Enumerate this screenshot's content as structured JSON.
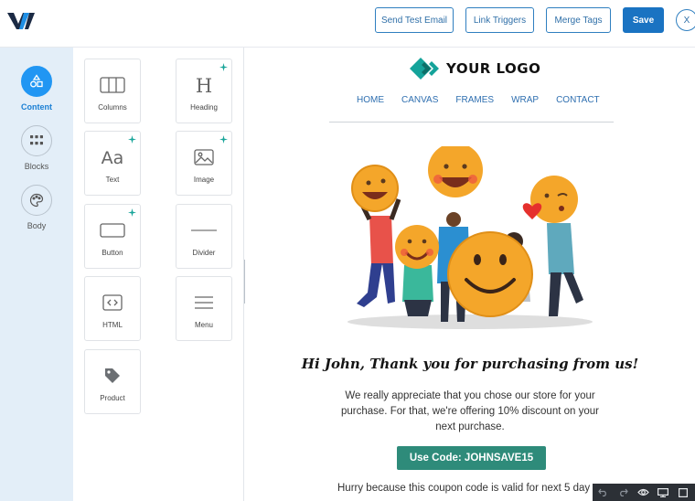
{
  "toolbar": {
    "send_test": "Send Test Email",
    "link_triggers": "Link Triggers",
    "merge_tags": "Merge Tags",
    "save": "Save",
    "close": "X"
  },
  "rail": [
    {
      "label": "Content",
      "icon": "shapes-icon",
      "active": true
    },
    {
      "label": "Blocks",
      "icon": "grid-icon",
      "active": false
    },
    {
      "label": "Body",
      "icon": "palette-icon",
      "active": false
    }
  ],
  "tools": [
    {
      "label": "Columns",
      "icon": "columns-icon",
      "ai": false
    },
    {
      "label": "Heading",
      "icon": "heading-icon",
      "ai": true
    },
    {
      "label": "Text",
      "icon": "text-icon",
      "ai": true
    },
    {
      "label": "Image",
      "icon": "image-icon",
      "ai": true
    },
    {
      "label": "Button",
      "icon": "button-icon",
      "ai": true
    },
    {
      "label": "Divider",
      "icon": "divider-icon",
      "ai": false
    },
    {
      "label": "HTML",
      "icon": "code-icon",
      "ai": false
    },
    {
      "label": "Menu",
      "icon": "menu-icon",
      "ai": false
    },
    {
      "label": "Product",
      "icon": "tag-icon",
      "ai": false
    }
  ],
  "email": {
    "logo_text": "YOUR LOGO",
    "nav": [
      "HOME",
      "CANVAS",
      "FRAMES",
      "WRAP",
      "CONTACT"
    ],
    "headline": "Hi John, Thank you for purchasing from us!",
    "body": "We really appreciate that you chose our store for your purchase. For that, we're offering 10% discount on your next purchase.",
    "coupon": "Use Code: JOHNSAVE15",
    "hurry": "Hurry because this coupon code is valid for next 5 day"
  },
  "colors": {
    "accent": "#1a73c2",
    "rail_bg": "#e3eef8",
    "coupon": "#2e8b7a",
    "logo_teal": "#14a39a"
  }
}
